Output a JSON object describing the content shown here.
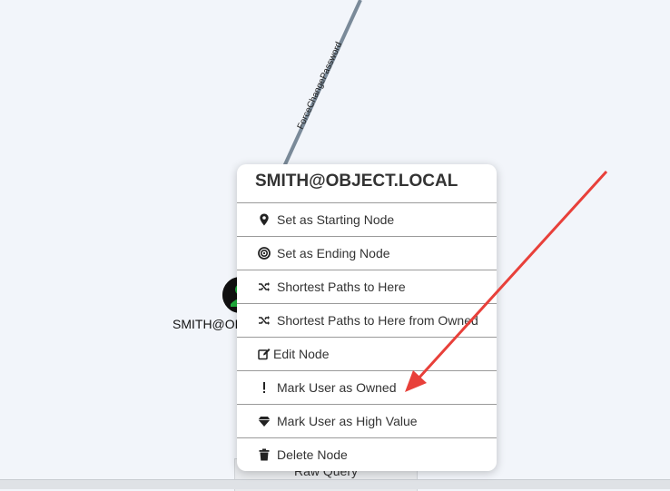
{
  "graph": {
    "edge_label": "ForceChangePassword",
    "node_label": "SMITH@OBJECT.LOCAL"
  },
  "bottom": {
    "raw_query_label": "Raw Query"
  },
  "context_menu": {
    "title": "SMITH@OBJECT.LOCAL",
    "items": [
      {
        "label": "Set as Starting Node",
        "icon": "map-marker-icon"
      },
      {
        "label": "Set as Ending Node",
        "icon": "bullseye-icon"
      },
      {
        "label": "Shortest Paths to Here",
        "icon": "random-icon"
      },
      {
        "label": "Shortest Paths to Here from Owned",
        "icon": "random-icon"
      },
      {
        "label": "Edit Node",
        "icon": "edit-icon"
      },
      {
        "label": "Mark User as Owned",
        "icon": "exclamation-icon"
      },
      {
        "label": "Mark User as High Value",
        "icon": "gem-icon"
      },
      {
        "label": "Delete Node",
        "icon": "trash-icon"
      }
    ]
  },
  "colors": {
    "canvas_bg": "#f2f5fa",
    "edge": "#7a8a99",
    "node": "#111111",
    "owned_marker": "#22cc44",
    "annotation_arrow": "#e8403a"
  }
}
